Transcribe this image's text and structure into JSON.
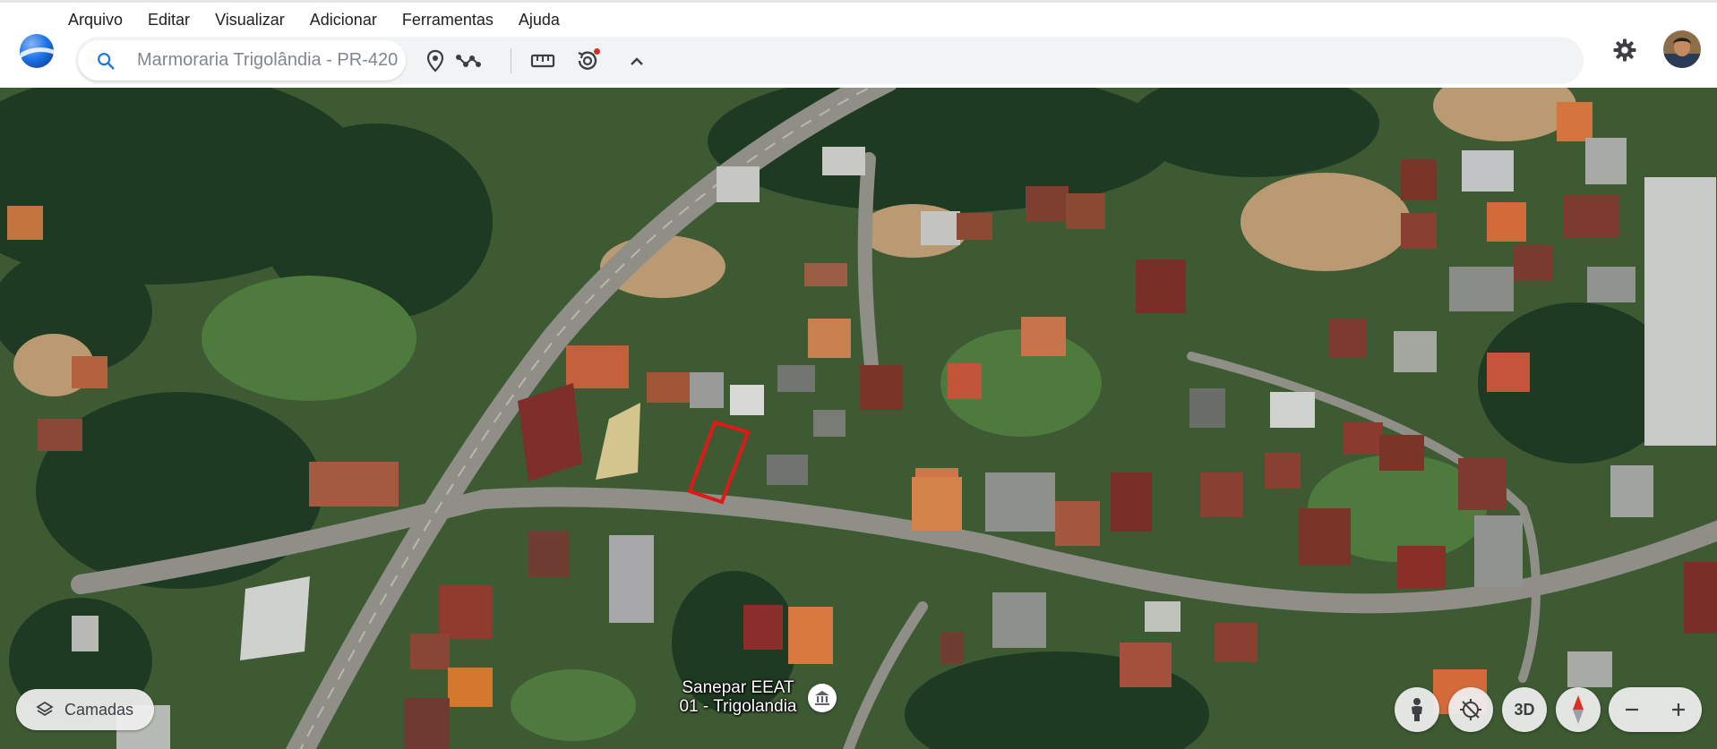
{
  "app": {
    "name": "Google Earth",
    "menu": [
      "Arquivo",
      "Editar",
      "Visualizar",
      "Adicionar",
      "Ferramentas",
      "Ajuda"
    ]
  },
  "toolbar": {
    "search_placeholder": "Marmoraria Trigolândia - PR-420",
    "tools": [
      "search-icon",
      "placemark-icon",
      "path-icon",
      "ruler-icon",
      "history-icon",
      "chevron-up-icon"
    ]
  },
  "header_right": {
    "icons": [
      "gear-icon",
      "avatar"
    ]
  },
  "map": {
    "place_label_line1": "Sanepar EEAT",
    "place_label_line2": "01 - Trigolandia",
    "place_icon": "landmark-icon",
    "selection_color": "#e01818"
  },
  "controls": {
    "layers_label": "Camadas",
    "view_3d_label": "3D",
    "icons": [
      "layers-icon",
      "pegman-icon",
      "location-off-icon",
      "compass-icon",
      "zoom-out-icon",
      "zoom-in-icon"
    ]
  },
  "colors": {
    "accent_blue": "#1a73e8",
    "notification_red": "#d93025"
  }
}
